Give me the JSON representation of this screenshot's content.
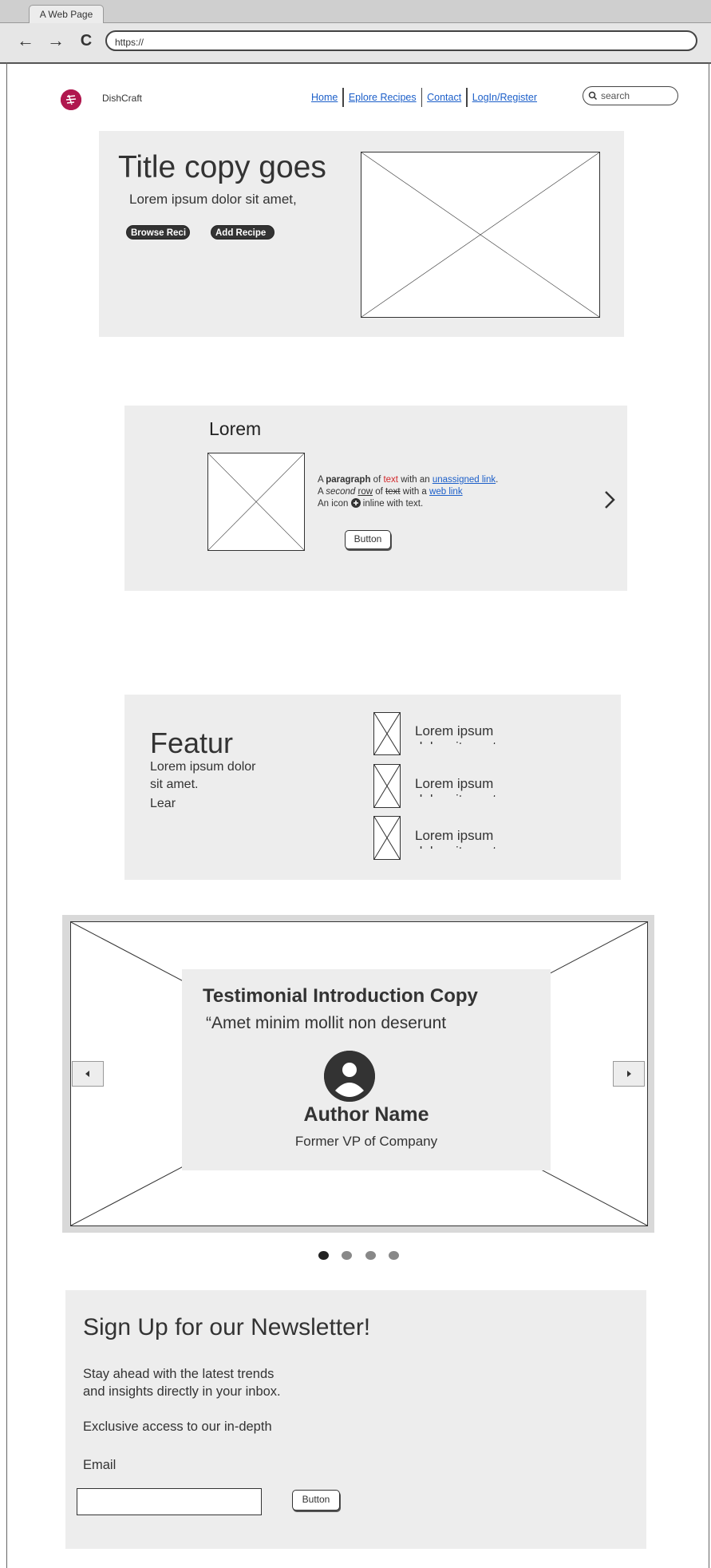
{
  "browser": {
    "tab_title": "A Web Page",
    "url": "https://",
    "back_icon": "←",
    "forward_icon": "→",
    "reload_icon": "C"
  },
  "nav": {
    "brand": "DishCraft",
    "links": [
      "Home",
      "Eplore Recipes",
      "Contact",
      "LogIn/Register"
    ],
    "search_placeholder": "search"
  },
  "hero": {
    "title": "Title copy goes",
    "subtitle": "Lorem ipsum dolor sit amet,",
    "buttons": [
      "Browse Reci",
      "Add Recipe"
    ]
  },
  "card": {
    "title": "Lorem",
    "lines": {
      "l1_a": "A ",
      "l1_bold": "paragraph",
      "l1_b": " of ",
      "l1_red": "text",
      "l1_c": " with an ",
      "l1_link": "unassigned link",
      "l1_d": ".",
      "l2_a": "A ",
      "l2_italic": "second",
      "l2_b": " ",
      "l2_under": "row",
      "l2_c": " of ",
      "l2_strike": "text",
      "l2_d": " with a ",
      "l2_link": "web link",
      "l3_a": "An icon ",
      "l3_b": " inline with text."
    },
    "button": "Button"
  },
  "features": {
    "heading": "Featur",
    "text": "Lorem ipsum dolor sit amet.",
    "link": "Lear",
    "items": [
      {
        "text": "Lorem ipsum dolor sit amet"
      },
      {
        "text": "Lorem ipsum dolor sit amet"
      },
      {
        "text": "Lorem ipsum dolor sit amet"
      }
    ]
  },
  "testimonial": {
    "title": "Testimonial Introduction Copy",
    "quote": "“Amet minim mollit non deserunt",
    "author": "Author Name",
    "role": "Former VP of Company",
    "dots_active_index": 0
  },
  "newsletter": {
    "title": "Sign Up for our Newsletter!",
    "p1_line1": "Stay ahead with the latest trends",
    "p1_line2": "and insights directly in your inbox.",
    "p2": "Exclusive access to our in-depth",
    "email_label": "Email",
    "button": "Button"
  },
  "colors": {
    "link": "#1c5fc9",
    "logo": "#b0174e",
    "panel": "#ededed",
    "red_text": "#d2292c"
  }
}
